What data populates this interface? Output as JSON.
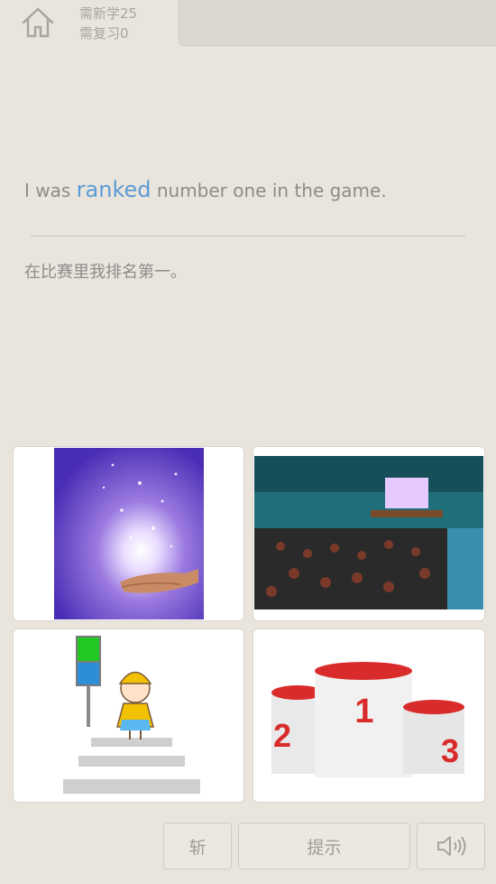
{
  "header": {
    "new_count": "需新学25",
    "review_count": "需复习0"
  },
  "sentence": {
    "before": "I was ",
    "word": "ranked",
    "after": " number one in the game."
  },
  "translation": "在比赛里我排名第一。",
  "options": [
    {
      "icon": "magic-hands-image"
    },
    {
      "icon": "conference-audience-image"
    },
    {
      "icon": "crosswalk-child-image"
    },
    {
      "icon": "winner-podium-image",
      "labels": [
        "1",
        "2",
        "3"
      ]
    }
  ],
  "toolbar": {
    "skip_label": "斩",
    "hint_label": "提示"
  },
  "colors": {
    "highlight": "#5b9bd5",
    "background": "#e9e5dc",
    "podium_red": "#d92b2b"
  }
}
